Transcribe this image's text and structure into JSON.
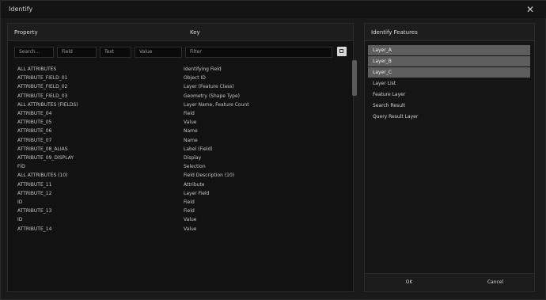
{
  "window": {
    "title": "Identify",
    "close_icon": "close-icon"
  },
  "main": {
    "col_name": "Property",
    "col_value": "Key",
    "filter_segments": [
      "Search…",
      "Field",
      "Text",
      "Value"
    ],
    "filter_value_placeholder": "Filter",
    "rows": [
      {
        "k": "ALL ATTRIBUTES",
        "v": "Identifying Field"
      },
      {
        "k": "ATTRIBUTE_FIELD_01",
        "v": "Object ID"
      },
      {
        "k": "ATTRIBUTE_FIELD_02",
        "v": "Layer (Feature Class)"
      },
      {
        "k": "ATTRIBUTE_FIELD_03",
        "v": "Geometry (Shape Type)"
      },
      {
        "k": "ALL ATTRIBUTES (FIELDS)",
        "v": "Layer Name, Feature Count"
      },
      {
        "k": "ATTRIBUTE_04",
        "v": "Field"
      },
      {
        "k": "ATTRIBUTE_05",
        "v": "Value"
      },
      {
        "k": "ATTRIBUTE_06",
        "v": "Name"
      },
      {
        "k": "ATTRIBUTE_07",
        "v": "Name"
      },
      {
        "k": "ATTRIBUTE_08_ALIAS",
        "v": "Label (Field)"
      },
      {
        "k": "ATTRIBUTE_09_DISPLAY",
        "v": "Display"
      },
      {
        "k": "FID",
        "v": "Selection"
      },
      {
        "k": "ALL ATTRIBUTES (10)",
        "v": "Field Description (10)"
      },
      {
        "k": "ATTRIBUTE_11",
        "v": "Attribute"
      },
      {
        "k": "ATTRIBUTE_12",
        "v": "Layer Field"
      },
      {
        "k": "ID",
        "v": "Field"
      },
      {
        "k": "ATTRIBUTE_13",
        "v": "Field"
      },
      {
        "k": "ID",
        "v": "Value"
      },
      {
        "k": "ATTRIBUTE_14",
        "v": "Value"
      }
    ]
  },
  "side": {
    "header": "Identify Features",
    "items": [
      "Layer_A",
      "Layer_B",
      "Layer_C",
      "Layer List",
      "Feature Layer",
      "Search Result",
      "Query Result Layer"
    ],
    "selected_indices": [
      0,
      1,
      2
    ],
    "ok_label": "OK",
    "cancel_label": "Cancel"
  }
}
